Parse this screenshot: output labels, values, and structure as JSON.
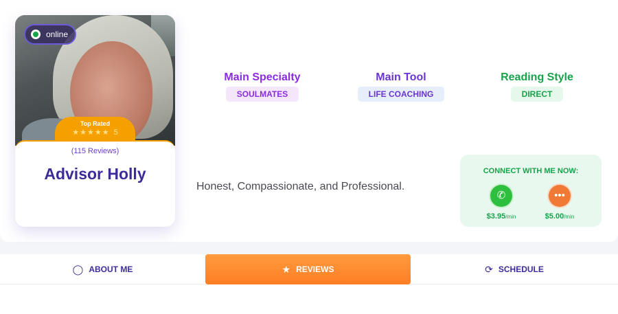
{
  "profile": {
    "status": "online",
    "badge_title": "Top Rated",
    "stars": "★★★★★",
    "rating": "5",
    "reviews_count": "(115 Reviews)",
    "name": "Advisor Holly"
  },
  "attributes": [
    {
      "label": "Main Specialty",
      "value": "SOULMATES",
      "label_color": "#8a2be2",
      "tag_bg": "#f4e6fb",
      "tag_color": "#8a2be2"
    },
    {
      "label": "Main Tool",
      "value": "LIFE COACHING",
      "label_color": "#6a35d0",
      "tag_bg": "#e6edfb",
      "tag_color": "#6a35d0"
    },
    {
      "label": "Reading Style",
      "value": "DIRECT",
      "label_color": "#16a34a",
      "tag_bg": "#e6f7ec",
      "tag_color": "#16a34a"
    }
  ],
  "tagline": "Honest, Compassionate, and Professional.",
  "connect": {
    "title": "CONNECT WITH ME NOW:",
    "call_price": "$3.95",
    "chat_price": "$5.00",
    "per_unit": "/min"
  },
  "tabs": [
    {
      "label": "ABOUT ME",
      "icon": "user-icon",
      "active": false
    },
    {
      "label": "REVIEWS",
      "icon": "reviews-icon",
      "active": true
    },
    {
      "label": "SCHEDULE",
      "icon": "schedule-icon",
      "active": false
    }
  ],
  "colors": {
    "accent_purple": "#3d2b9a",
    "accent_orange": "#ff8a2e",
    "accent_green": "#16a34a"
  }
}
